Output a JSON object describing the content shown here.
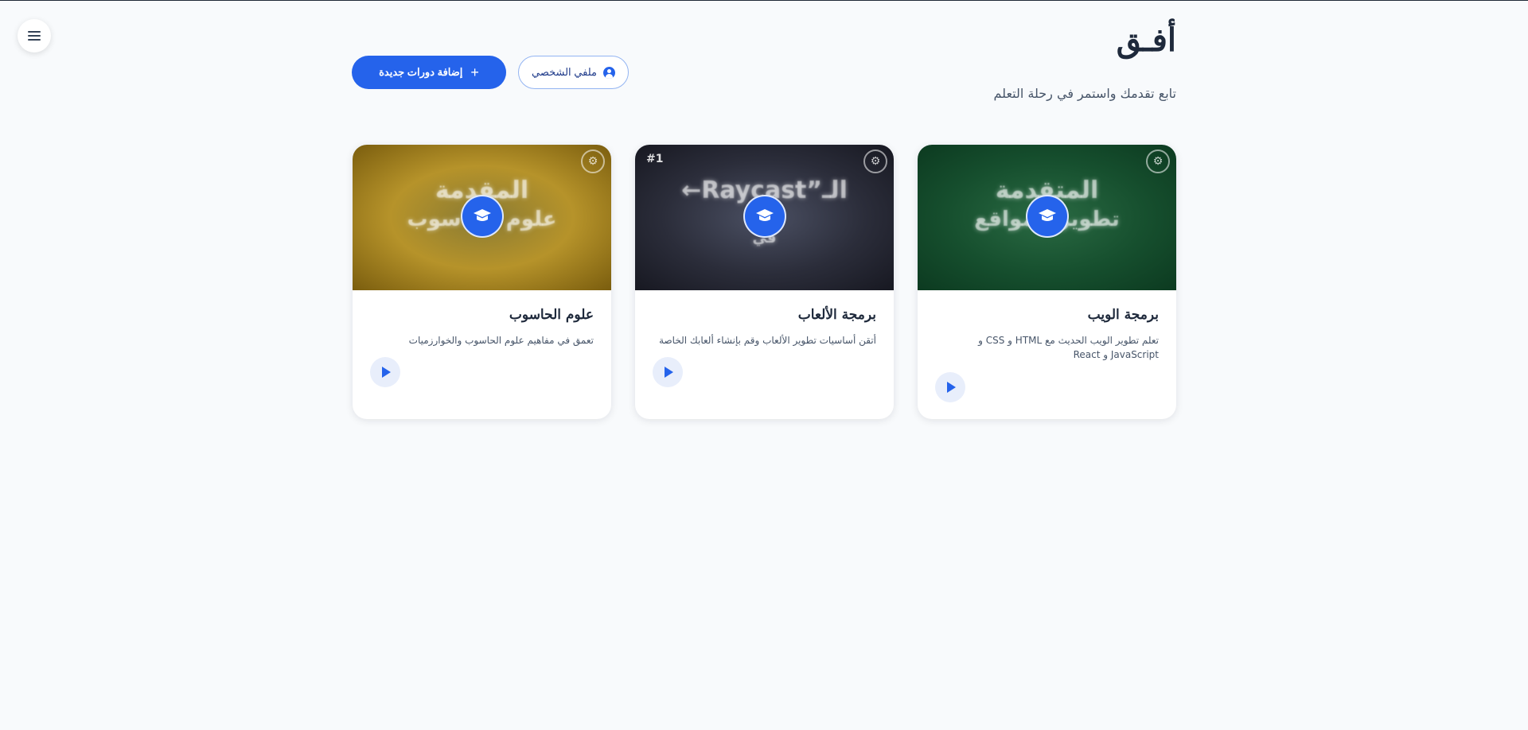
{
  "app": {
    "brand": "أفـق",
    "subtitle": "تابع تقدمك واستمر في رحلة التعلم"
  },
  "header": {
    "add_courses_label": "إضافة دورات جديدة",
    "profile_label": "ملفي الشخصي"
  },
  "icons": {
    "menu": "hamburger-menu-icon",
    "plus": "plus-icon",
    "user": "user-circle-icon",
    "cap": "graduation-cap-icon",
    "play": "play-icon",
    "bulb": "lightbulb-gear-icon"
  },
  "colors": {
    "accent": "#2563eb",
    "background": "#f8fafc",
    "title": "#1e293b"
  },
  "courses": [
    {
      "title": "برمجة الويب",
      "description": "تعلم تطوير الويب الحديث مع HTML و CSS و JavaScript و React",
      "thumb_text_1": "المتقدمة",
      "thumb_text_2": "تطوير المواقع",
      "badge": ""
    },
    {
      "title": "برمجة الألعاب",
      "description": "أتقن أساسيات تطوير الألعاب وقم بإنشاء ألعابك الخاصة",
      "thumb_text_1": "←Raycast”الـ",
      "thumb_text_2": "في",
      "badge": "#1"
    },
    {
      "title": "علوم الحاسوب",
      "description": "تعمق في مفاهيم علوم الحاسوب والخوارزميات",
      "thumb_text_1": "المقدمة",
      "thumb_text_2": "علوم الحاسوب",
      "badge": ""
    }
  ]
}
